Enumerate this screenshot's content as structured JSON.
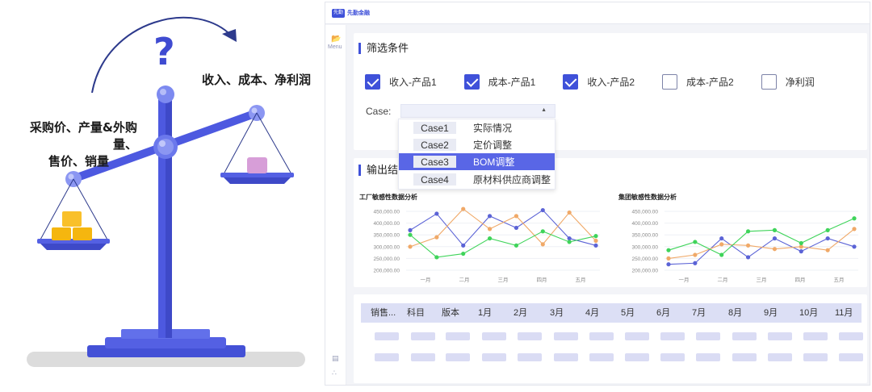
{
  "illustration": {
    "question_mark": "?",
    "right_label": "收入、成本、净利润",
    "left_label_line1": "采购价、产量&外购量、",
    "left_label_line2": "售价、销量",
    "colors": {
      "scale": "#4e5ae3",
      "arrow": "#2d3a8c",
      "gold": "#f5b60f",
      "pink": "#d79ed8",
      "shadow": "#dcdcdc"
    }
  },
  "app": {
    "logo_badge": "先勤",
    "logo_text": "先勤金融",
    "sidebar": {
      "menu_label": "Menu"
    },
    "filter": {
      "title": "筛选条件",
      "checkboxes": [
        {
          "label": "收入-产品1",
          "checked": true
        },
        {
          "label": "成本-产品1",
          "checked": true
        },
        {
          "label": "收入-产品2",
          "checked": true
        },
        {
          "label": "成本-产品2",
          "checked": false
        },
        {
          "label": "净利润",
          "checked": false
        }
      ],
      "case_label": "Case:",
      "case_options": [
        {
          "code": "Case1",
          "name": "实际情况",
          "selected": false
        },
        {
          "code": "Case2",
          "name": "定价调整",
          "selected": false
        },
        {
          "code": "Case3",
          "name": "BOM调整",
          "selected": true
        },
        {
          "code": "Case4",
          "name": "原材料供应商调整",
          "selected": false
        }
      ]
    },
    "output": {
      "title": "输出结果"
    },
    "table": {
      "headers": [
        "销售...",
        "科目",
        "版本",
        "1月",
        "2月",
        "3月",
        "4月",
        "5月",
        "6月",
        "7月",
        "8月",
        "9月",
        "10月",
        "11月"
      ]
    },
    "colors": {
      "accent": "#3f51d9",
      "selected": "#5966e6",
      "series_blue": "#5b63d6",
      "series_orange": "#f0a968",
      "series_green": "#3fd45a"
    }
  },
  "chart_data": [
    {
      "type": "line",
      "title": "工厂敏感性数据分析",
      "categories": [
        "一月",
        "二月",
        "三月",
        "四月",
        "五月"
      ],
      "ylim": [
        200000,
        450000
      ],
      "y_ticks": [
        "450,000.00",
        "400,000.00",
        "350,000.00",
        "300,000.00",
        "250,000.00",
        "200,000.00"
      ],
      "series": [
        {
          "color": "#5b63d6",
          "values": [
            370000,
            440000,
            305000,
            430000,
            380000,
            455000,
            335000,
            305000
          ]
        },
        {
          "color": "#f0a968",
          "values": [
            300000,
            340000,
            460000,
            375000,
            430000,
            310000,
            445000,
            325000
          ]
        },
        {
          "color": "#3fd45a",
          "values": [
            350000,
            255000,
            270000,
            335000,
            305000,
            365000,
            320000,
            345000
          ]
        }
      ]
    },
    {
      "type": "line",
      "title": "集团敏感性数据分析",
      "categories": [
        "一月",
        "二月",
        "三月",
        "四月",
        "五月"
      ],
      "ylim": [
        200000,
        450000
      ],
      "y_ticks": [
        "450,000.00",
        "400,000.00",
        "350,000.00",
        "300,000.00",
        "250,000.00",
        "200,000.00"
      ],
      "series": [
        {
          "color": "#5b63d6",
          "values": [
            225000,
            230000,
            335000,
            255000,
            335000,
            280000,
            335000,
            300000
          ]
        },
        {
          "color": "#f0a968",
          "values": [
            250000,
            265000,
            310000,
            305000,
            290000,
            300000,
            285000,
            375000
          ]
        },
        {
          "color": "#3fd45a",
          "values": [
            285000,
            320000,
            265000,
            365000,
            370000,
            315000,
            370000,
            420000
          ]
        }
      ]
    }
  ]
}
